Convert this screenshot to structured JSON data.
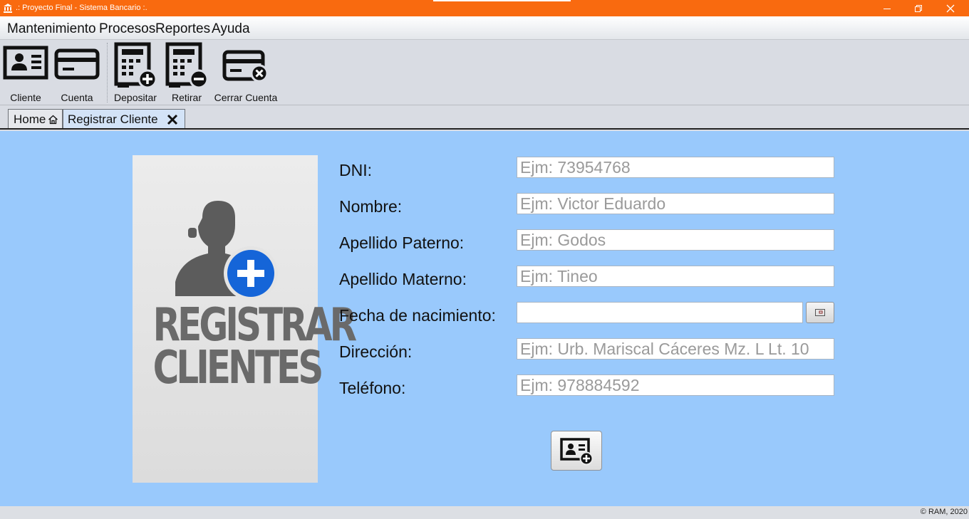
{
  "window": {
    "title": ".: Proyecto Final - Sistema Bancario :."
  },
  "menu": {
    "items": [
      "Mantenimiento",
      "Procesos",
      "Reportes",
      "Ayuda"
    ]
  },
  "toolbar": {
    "cliente": "Cliente",
    "cuenta": "Cuenta",
    "depositar": "Depositar",
    "retirar": "Retirar",
    "cerrar_cuenta": "Cerrar Cuenta"
  },
  "tabs": {
    "home": "Home",
    "registrar": "Registrar Cliente"
  },
  "poster": {
    "line1": "REGISTRAR",
    "line2": "CLIENTES"
  },
  "form": {
    "dni": {
      "label": "DNI:",
      "placeholder": "Ejm: 73954768"
    },
    "nombre": {
      "label": "Nombre:",
      "placeholder": "Ejm: Victor Eduardo"
    },
    "apellido_paterno": {
      "label": "Apellido Paterno:",
      "placeholder": "Ejm: Godos"
    },
    "apellido_materno": {
      "label": "Apellido Materno:",
      "placeholder": "Ejm: Tineo"
    },
    "fecha": {
      "label": "Fecha de nacimiento:",
      "value": ""
    },
    "direccion": {
      "label": "Dirección:",
      "placeholder": "Ejm: Urb. Mariscal Cáceres Mz. L Lt. 10"
    },
    "telefono": {
      "label": "Teléfono:",
      "placeholder": "Ejm: 978884592"
    }
  },
  "status": {
    "copyright": "© RAM, 2020"
  },
  "colors": {
    "titlebar": "#f96a0f",
    "content_bg": "#99c9fc",
    "plus_badge": "#1565d8",
    "icon": "#111111"
  }
}
